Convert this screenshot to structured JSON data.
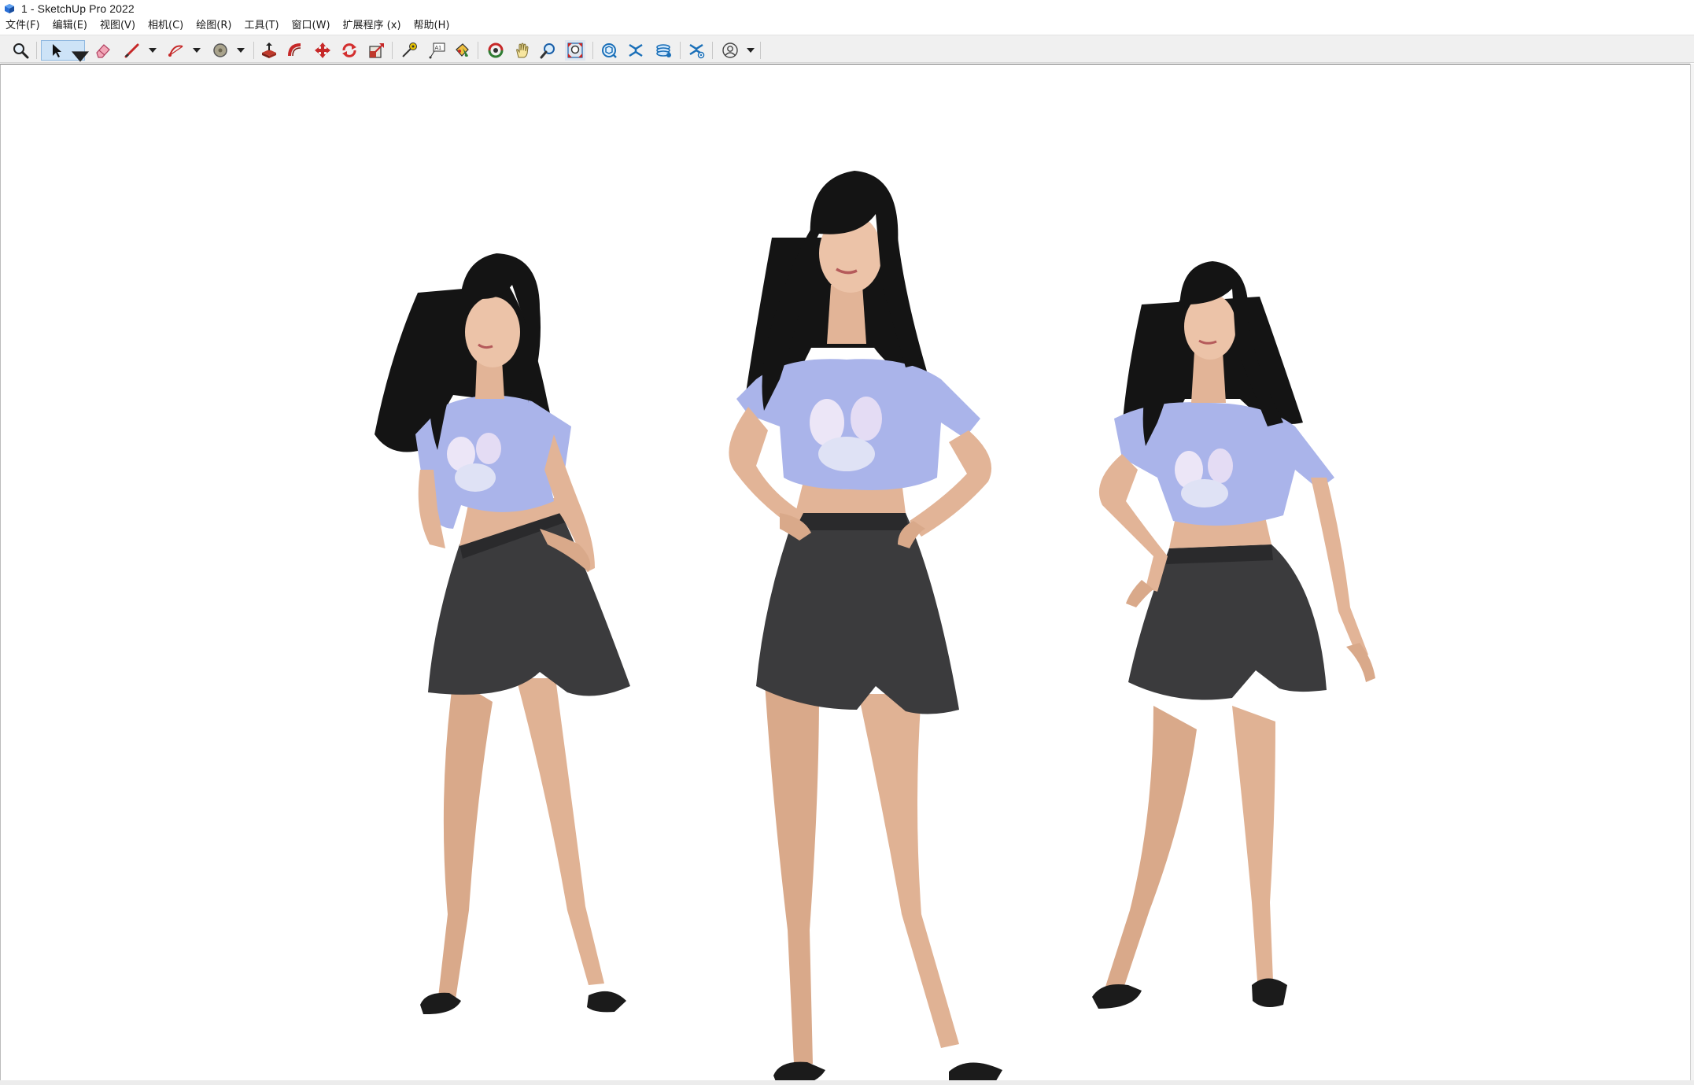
{
  "window": {
    "title": "1 - SketchUp Pro 2022"
  },
  "menu": [
    {
      "label": "文件(F)"
    },
    {
      "label": "编辑(E)"
    },
    {
      "label": "视图(V)"
    },
    {
      "label": "相机(C)"
    },
    {
      "label": "绘图(R)"
    },
    {
      "label": "工具(T)"
    },
    {
      "label": "窗口(W)"
    },
    {
      "label": "扩展程序 (x)"
    },
    {
      "label": "帮助(H)"
    }
  ],
  "toolbar": {
    "tools": [
      {
        "icon": "zoom-icon"
      },
      {
        "icon": "select-arrow-icon",
        "active": true
      },
      {
        "icon": "eraser-icon"
      },
      {
        "icon": "pencil-line-icon"
      },
      {
        "icon": "arc-icon"
      },
      {
        "icon": "circle-shape-icon"
      },
      {
        "icon": "push-pull-icon"
      },
      {
        "icon": "follow-me-icon"
      },
      {
        "icon": "move-icon"
      },
      {
        "icon": "rotate-icon"
      },
      {
        "icon": "scale-icon"
      },
      {
        "icon": "tape-measure-icon"
      },
      {
        "icon": "text-label-icon"
      },
      {
        "icon": "paint-bucket-icon"
      },
      {
        "icon": "orbit-icon"
      },
      {
        "icon": "pan-hand-icon"
      },
      {
        "icon": "zoom-window-icon"
      },
      {
        "icon": "zoom-extents-icon"
      },
      {
        "icon": "3d-warehouse-icon"
      },
      {
        "icon": "extension-warehouse-icon"
      },
      {
        "icon": "layout-send-icon"
      },
      {
        "icon": "extension-manager-icon"
      },
      {
        "icon": "account-user-icon"
      }
    ],
    "text_tool_glyph": "A1"
  },
  "colors": {
    "toolbar_bg": "#f0f0f0",
    "active_tool_bg": "#cde3f7",
    "shirt": "#aab4ea",
    "shorts": "#3b3b3d",
    "skin": "#e2b497",
    "hair": "#141414"
  },
  "scene": {
    "figures": [
      {
        "name": "left-figure",
        "pose": "leaning, hand on hip"
      },
      {
        "name": "center-figure",
        "pose": "hands on hips"
      },
      {
        "name": "right-figure",
        "pose": "one hand on hip"
      }
    ]
  }
}
